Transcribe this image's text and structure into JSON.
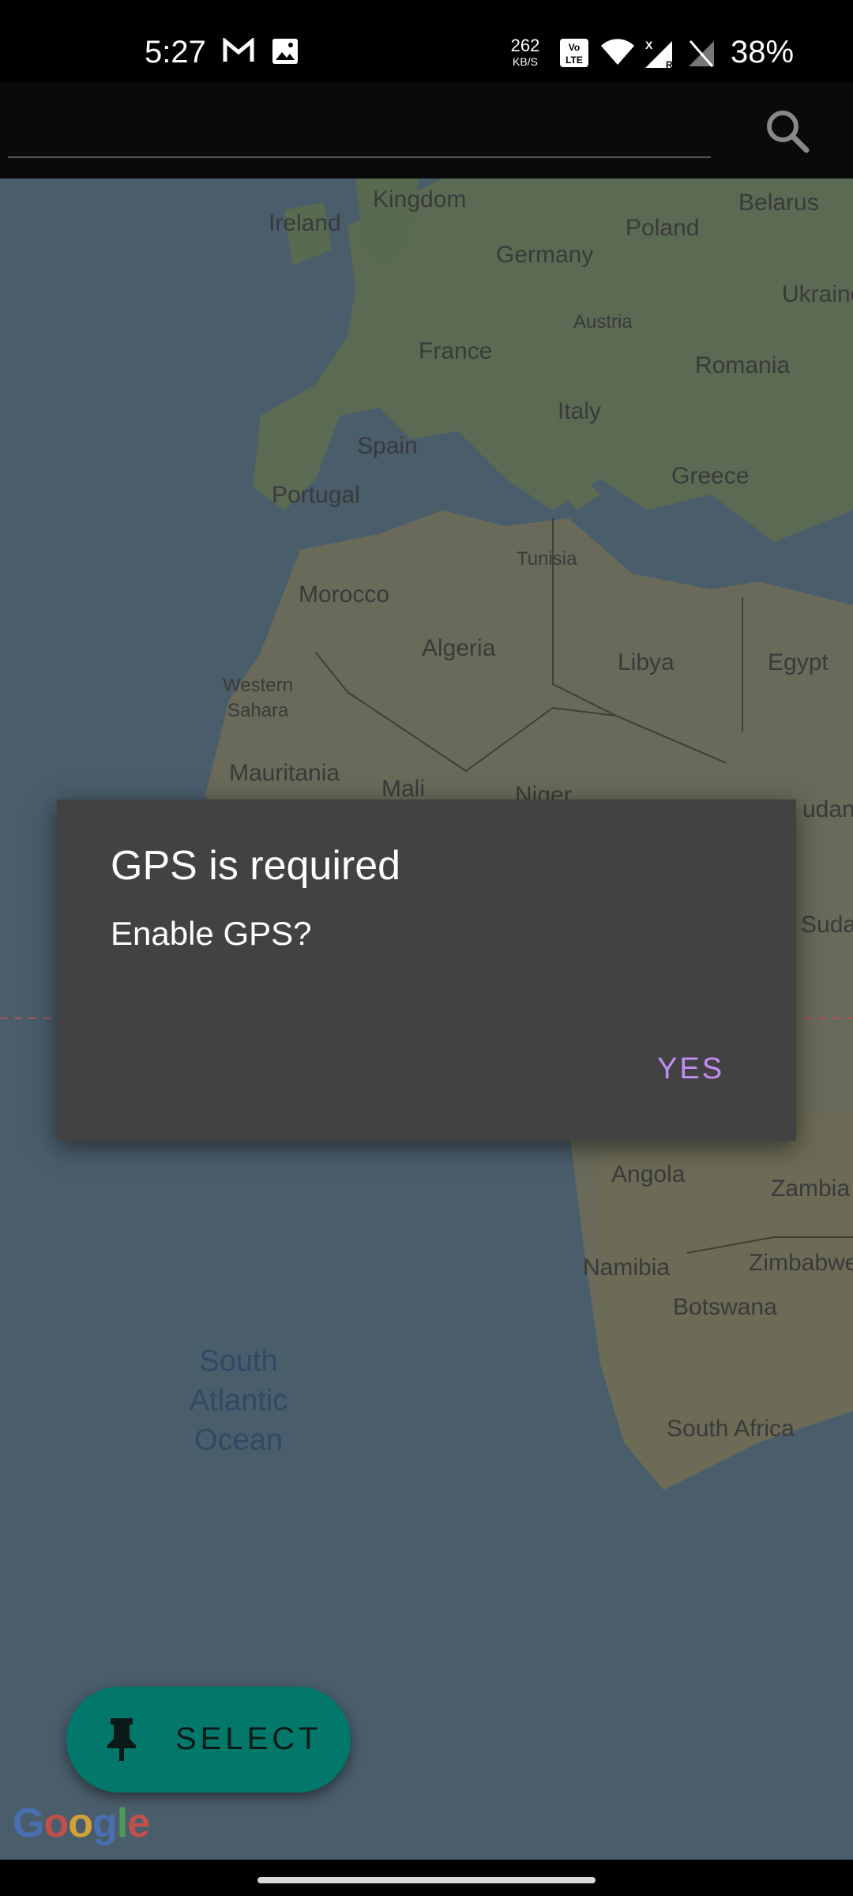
{
  "status_bar": {
    "time": "5:27",
    "net_speed_value": "262",
    "net_speed_unit": "KB/S",
    "battery": "38%",
    "icons": [
      "gmail-icon",
      "gallery-icon",
      "volte-icon",
      "wifi-icon",
      "signal-icon",
      "no-sim-icon",
      "battery-icon"
    ]
  },
  "search": {
    "placeholder": "",
    "icon": "search-icon"
  },
  "map": {
    "labels": {
      "united_kingdom": "Kingdom",
      "ireland": "Ireland",
      "belarus": "Belarus",
      "poland": "Poland",
      "germany": "Germany",
      "ukraine": "Ukraine",
      "austria": "Austria",
      "france": "France",
      "romania": "Romania",
      "italy": "Italy",
      "spain": "Spain",
      "portugal": "Portugal",
      "greece": "Greece",
      "tunisia": "Tunisia",
      "morocco": "Morocco",
      "algeria": "Algeria",
      "libya": "Libya",
      "egypt": "Egypt",
      "western_sahara_1": "Western",
      "western_sahara_2": "Sahara",
      "mauritania": "Mauritania",
      "mali": "Mali",
      "niger": "Niger",
      "sudan": "udan",
      "south_sudan": "Suda",
      "angola": "Angola",
      "zambia": "Zambia",
      "namibia": "Namibia",
      "zimbabwe": "Zimbabwe",
      "botswana": "Botswana",
      "south_africa": "South Africa",
      "ocean_1": "South",
      "ocean_2": "Atlantic",
      "ocean_3": "Ocean"
    },
    "attribution": "Google"
  },
  "dialog": {
    "title": "GPS is required",
    "message": "Enable GPS?",
    "positive_button": "YES",
    "accent_color": "#c28df0"
  },
  "fab": {
    "label": "SELECT",
    "icon": "pin-icon",
    "color": "#01786a"
  }
}
